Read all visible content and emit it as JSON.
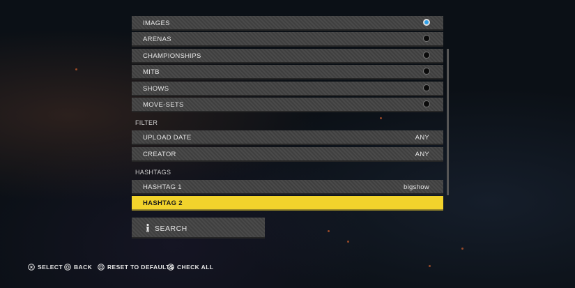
{
  "options": [
    {
      "label": "IMAGES",
      "selected": true
    },
    {
      "label": "ARENAS",
      "selected": false
    },
    {
      "label": "CHAMPIONSHIPS",
      "selected": false
    },
    {
      "label": "MITB",
      "selected": false
    },
    {
      "label": "SHOWS",
      "selected": false
    },
    {
      "label": "MOVE-SETS",
      "selected": false
    }
  ],
  "filter": {
    "heading": "FILTER",
    "upload_date": {
      "label": "UPLOAD DATE",
      "value": "ANY"
    },
    "creator": {
      "label": "CREATOR",
      "value": "ANY"
    }
  },
  "hashtags": {
    "heading": "HASHTAGS",
    "hashtag1": {
      "label": "HASHTAG 1",
      "value": "bigshow"
    },
    "hashtag2": {
      "label": "HASHTAG 2",
      "value": ""
    }
  },
  "search": {
    "label": "SEARCH",
    "icon": "wrestler-figure-icon"
  },
  "controls": [
    {
      "icon": "cross-button-icon",
      "label": "SELECT"
    },
    {
      "icon": "circle-button-icon",
      "label": "BACK"
    },
    {
      "icon": "square-button-icon",
      "label": "RESET TO DEFAULTS"
    },
    {
      "icon": "triangle-button-icon",
      "label": "CHECK ALL"
    }
  ],
  "colors": {
    "accent": "#f2d32c",
    "radio_on": "#2fa0e8"
  }
}
